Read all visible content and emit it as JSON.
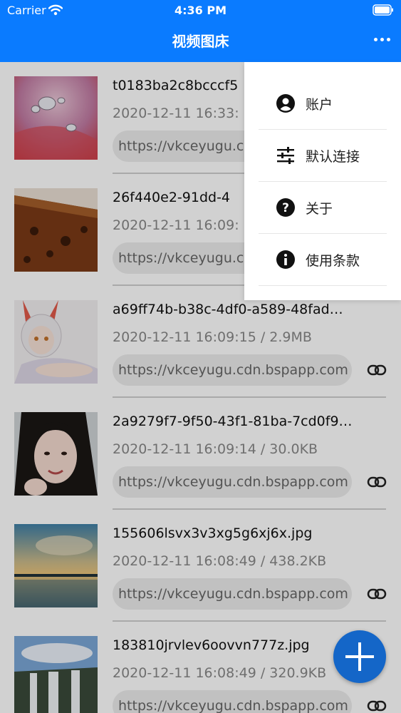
{
  "status_bar": {
    "carrier": "Carrier",
    "time": "4:36 PM",
    "wifi_icon": "wifi-icon",
    "battery_icon": "battery-icon"
  },
  "header": {
    "title": "视频图床",
    "more_icon": "more-horizontal-icon"
  },
  "items": [
    {
      "filename": "t0183ba2c8bcccf5",
      "meta": "2020-12-11 16:33:",
      "url": "https://vkceyugu.cdn.bspapp.com",
      "thumb": "water-drops"
    },
    {
      "filename": "26f440e2-91dd-4",
      "meta": "2020-12-11 16:09:",
      "url": "https://vkceyugu.cdn.bspapp.com",
      "thumb": "cake"
    },
    {
      "filename": "a69ff74b-b38c-4df0-a589-48fad…",
      "meta": "2020-12-11 16:09:15 / 2.9MB",
      "url": "https://vkceyugu.cdn.bspapp.com",
      "thumb": "anime-girl"
    },
    {
      "filename": "2a9279f7-9f50-43f1-81ba-7cd0f9…",
      "meta": "2020-12-11 16:09:14 / 30.0KB",
      "url": "https://vkceyugu.cdn.bspapp.com",
      "thumb": "portrait"
    },
    {
      "filename": "155606lsvx3v3xg5g6xj6x.jpg",
      "meta": "2020-12-11 16:08:49 / 438.2KB",
      "url": "https://vkceyugu.cdn.bspapp.com",
      "thumb": "sunset-sea"
    },
    {
      "filename": "183810jrvlev6oovvn777z.jpg",
      "meta": "2020-12-11 16:08:49 / 320.9KB",
      "url": "https://vkceyugu.cdn.bspapp.com",
      "thumb": "waterfall"
    }
  ],
  "menu": {
    "items": [
      {
        "label": "账户",
        "icon": "account-circle-icon"
      },
      {
        "label": "默认连接",
        "icon": "sliders-icon"
      },
      {
        "label": "关于",
        "icon": "help-circle-icon"
      },
      {
        "label": "使用条款",
        "icon": "info-circle-icon"
      }
    ]
  },
  "fab": {
    "icon": "plus-icon"
  },
  "colors": {
    "header": "#0a7bff",
    "fab": "#1466c8"
  }
}
